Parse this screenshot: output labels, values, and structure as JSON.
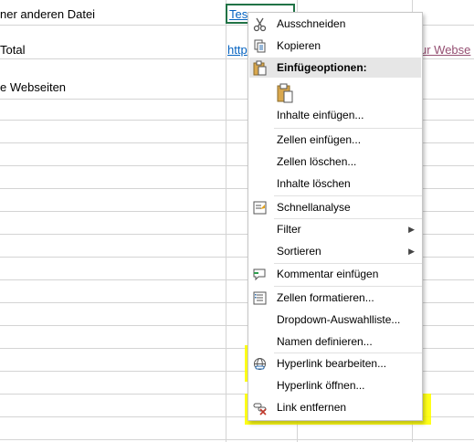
{
  "sheet": {
    "rows": [
      {
        "text": "ner anderen Datei"
      },
      {
        "text": "Total"
      },
      {
        "text": "e Webseiten"
      }
    ],
    "active_cell_text": "Tes",
    "row2_link_text": "http",
    "row2_right_link_text": "ur Webse"
  },
  "context_menu": {
    "items": [
      {
        "label": "Ausschneiden",
        "icon": "scissors-icon"
      },
      {
        "label": "Kopieren",
        "icon": "copy-icon"
      },
      {
        "label": "Einfügeoptionen:",
        "icon": "paste-icon",
        "section": true
      },
      {
        "label": "Inhalte einfügen...",
        "icon": ""
      },
      {
        "label": "Zellen einfügen...",
        "icon": ""
      },
      {
        "label": "Zellen löschen...",
        "icon": ""
      },
      {
        "label": "Inhalte löschen",
        "icon": ""
      },
      {
        "label": "Schnellanalyse",
        "icon": "quick-analysis-icon"
      },
      {
        "label": "Filter",
        "icon": "",
        "submenu": true
      },
      {
        "label": "Sortieren",
        "icon": "",
        "submenu": true
      },
      {
        "label": "Kommentar einfügen",
        "icon": "comment-icon"
      },
      {
        "label": "Zellen formatieren...",
        "icon": "format-cells-icon"
      },
      {
        "label": "Dropdown-Auswahlliste...",
        "icon": ""
      },
      {
        "label": "Namen definieren...",
        "icon": ""
      },
      {
        "label": "Hyperlink bearbeiten...",
        "icon": "hyperlink-edit-icon",
        "highlighted": true
      },
      {
        "label": "Hyperlink öffnen...",
        "icon": ""
      },
      {
        "label": "Link entfernen",
        "icon": "remove-link-icon",
        "highlighted": true
      }
    ],
    "submenu_arrow": "▶"
  },
  "colors": {
    "highlight": "#ffff00",
    "link": "#0563c1",
    "visited_link": "#954f72",
    "active_cell_border": "#217346"
  }
}
